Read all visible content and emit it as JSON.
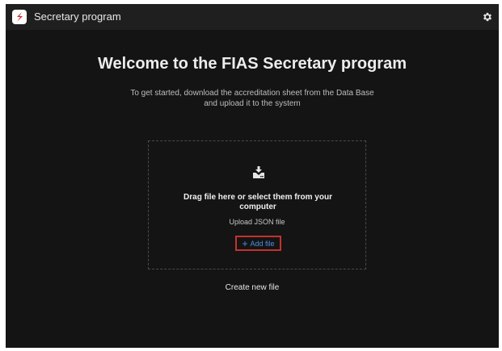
{
  "app": {
    "title": "Secretary program"
  },
  "icons": {
    "logo": "app-logo-icon",
    "settings": "gear-icon",
    "drive": "hard-drive-download-icon",
    "add": "plus-icon"
  },
  "colors": {
    "window_bg": "#141414",
    "titlebar_bg": "#1f1f1f",
    "logo_accent": "#d7262b",
    "link": "#4c8fe6",
    "highlight_border": "#c3332c"
  },
  "main": {
    "heading": "Welcome to the FIAS Secretary program",
    "subtext": "To get started, download the accreditation sheet from the Data Base and upload it to the system"
  },
  "dropzone": {
    "title": "Drag file here or select them from your computer",
    "hint": "Upload JSON file",
    "add_label": "Add file"
  },
  "footer": {
    "create_new": "Create new file"
  }
}
